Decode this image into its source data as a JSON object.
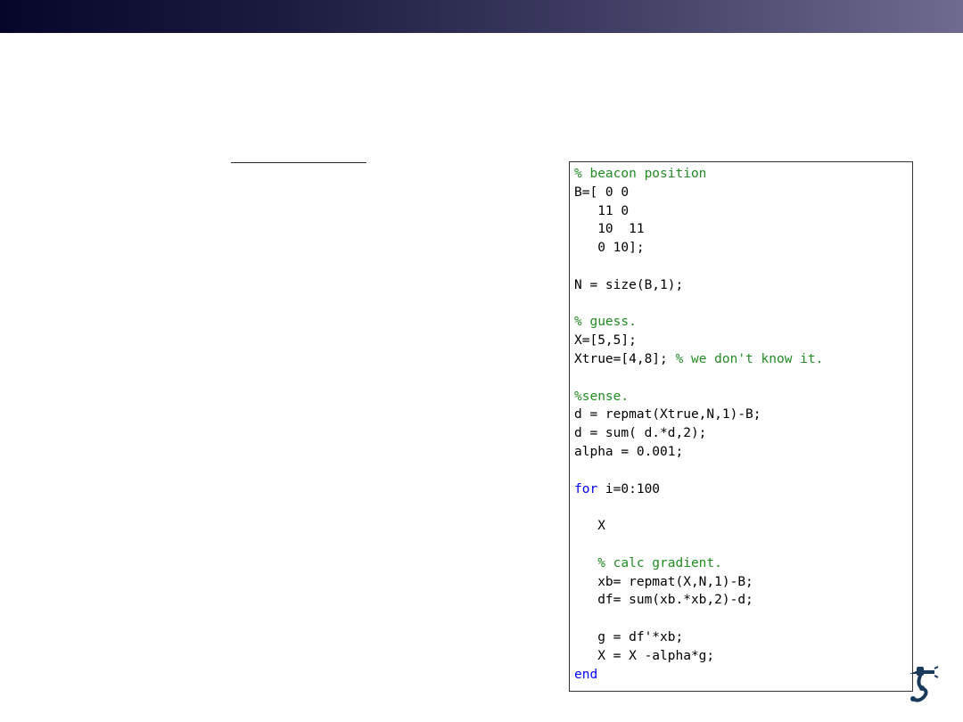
{
  "colors": {
    "header_gradient_start": "#06062a",
    "header_gradient_end": "#6e6a90",
    "comment": "#228b22",
    "keyword": "#0000ff",
    "code": "#000000",
    "logo": "#1a3a5c"
  },
  "logo_icon": "robot-arm-logo-icon",
  "code": {
    "lines": [
      {
        "segments": [
          {
            "type": "comment",
            "text": "% beacon position"
          }
        ]
      },
      {
        "segments": [
          {
            "type": "code",
            "text": "B=[ 0 0"
          }
        ]
      },
      {
        "segments": [
          {
            "type": "code",
            "text": "   11 0"
          }
        ]
      },
      {
        "segments": [
          {
            "type": "code",
            "text": "   10  11"
          }
        ]
      },
      {
        "segments": [
          {
            "type": "code",
            "text": "   0 10];"
          }
        ]
      },
      {
        "segments": []
      },
      {
        "segments": [
          {
            "type": "code",
            "text": "N = size(B,1);"
          }
        ]
      },
      {
        "segments": []
      },
      {
        "segments": [
          {
            "type": "comment",
            "text": "% guess."
          }
        ]
      },
      {
        "segments": [
          {
            "type": "code",
            "text": "X=[5,5];"
          }
        ]
      },
      {
        "segments": [
          {
            "type": "code",
            "text": "Xtrue=[4,8]; "
          },
          {
            "type": "comment",
            "text": "% we don't know it."
          }
        ]
      },
      {
        "segments": []
      },
      {
        "segments": [
          {
            "type": "comment",
            "text": "%sense."
          }
        ]
      },
      {
        "segments": [
          {
            "type": "code",
            "text": "d = repmat(Xtrue,N,1)-B;"
          }
        ]
      },
      {
        "segments": [
          {
            "type": "code",
            "text": "d = sum( d.*d,2);"
          }
        ]
      },
      {
        "segments": [
          {
            "type": "code",
            "text": "alpha = 0.001;"
          }
        ]
      },
      {
        "segments": []
      },
      {
        "segments": [
          {
            "type": "keyword",
            "text": "for"
          },
          {
            "type": "code",
            "text": " i=0:100"
          }
        ]
      },
      {
        "segments": []
      },
      {
        "segments": [
          {
            "type": "code",
            "text": "   X"
          }
        ]
      },
      {
        "segments": []
      },
      {
        "segments": [
          {
            "type": "comment",
            "text": "   % calc gradient."
          }
        ]
      },
      {
        "segments": [
          {
            "type": "code",
            "text": "   xb= repmat(X,N,1)-B;"
          }
        ]
      },
      {
        "segments": [
          {
            "type": "code",
            "text": "   df= sum(xb.*xb,2)-d;"
          }
        ]
      },
      {
        "segments": []
      },
      {
        "segments": [
          {
            "type": "code",
            "text": "   g = df'*xb;"
          }
        ]
      },
      {
        "segments": [
          {
            "type": "code",
            "text": "   X = X -alpha*g;"
          }
        ]
      },
      {
        "segments": [
          {
            "type": "keyword",
            "text": "end"
          }
        ]
      }
    ]
  }
}
